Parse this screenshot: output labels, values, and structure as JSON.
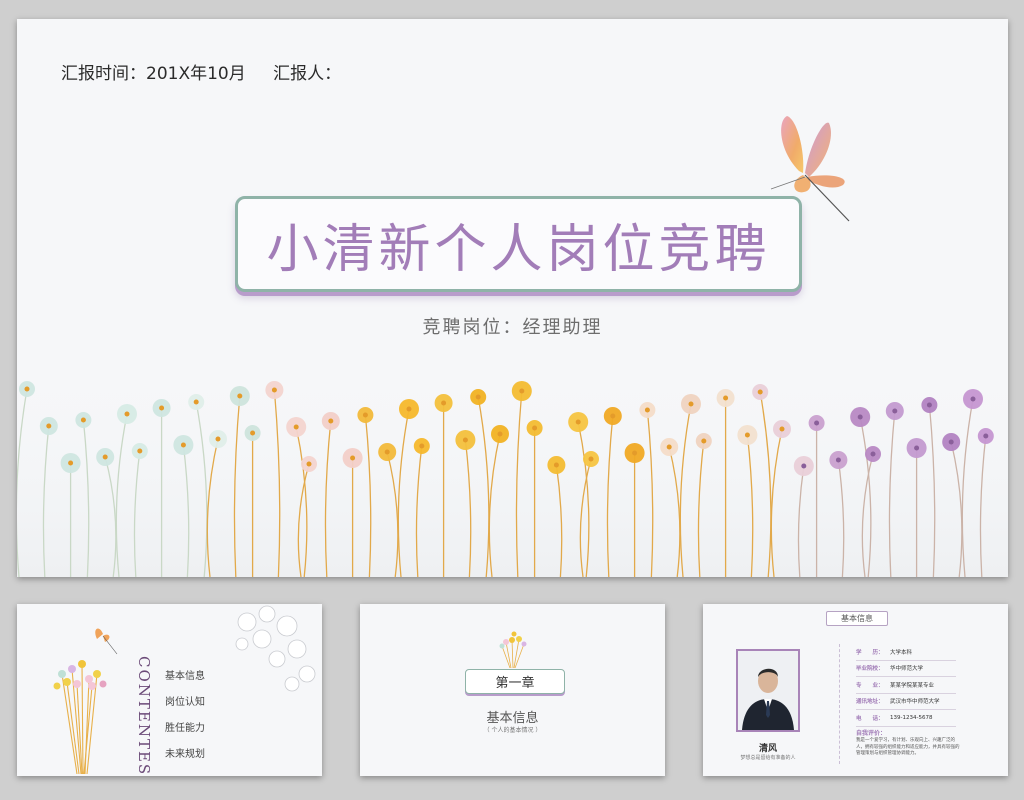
{
  "main_slide": {
    "report_time": "汇报时间：201X年10月",
    "reporter": "汇报人：",
    "title": "小清新个人岗位竞聘",
    "subtitle": "竞聘岗位：经理助理",
    "colors": {
      "accent_purple": "#a27db8",
      "border_green": "#8fb3a8",
      "flower_yellow": "#f0b020"
    }
  },
  "contents_slide": {
    "heading": "CONTENTES",
    "items": [
      "基本信息",
      "岗位认知",
      "胜任能力",
      "未来规划"
    ]
  },
  "chapter_slide": {
    "chapter": "第一章",
    "title": "基本信息",
    "subtitle": "（ 个人的基本情况 ）"
  },
  "info_slide": {
    "tag": "基本信息",
    "name": "清风",
    "motto": "梦想总是留给有准备的人",
    "rows": [
      {
        "key": "学　　历：",
        "value": "大学本科"
      },
      {
        "key": "毕业院校：",
        "value": "华中师范大学"
      },
      {
        "key": "专　　业：",
        "value": "某某学院某某专业"
      },
      {
        "key": "通讯地址：",
        "value": "武汉市华中师范大学"
      },
      {
        "key": "电　　话：",
        "value": "139-1234-5678"
      }
    ],
    "eval_label": "自我评价：",
    "eval_text": "我是一个爱学习，有计划、乐观向上、兴趣广泛的人，拥有较强的组织能力和适应能力，并具有较强的管理策划与组织管理协调能力。"
  }
}
